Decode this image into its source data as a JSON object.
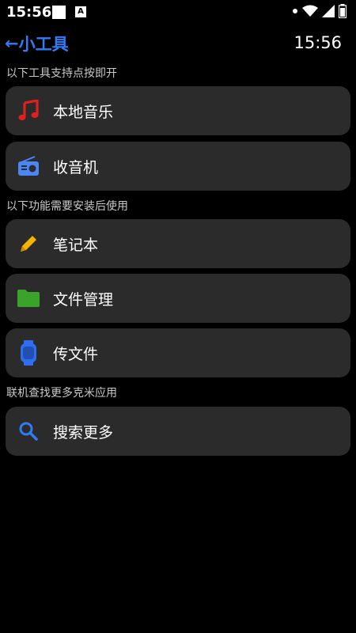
{
  "status_bar": {
    "time": "15:56",
    "notification_letter": "A"
  },
  "header": {
    "title": "小工具",
    "back_arrow": "←",
    "time": "15:56"
  },
  "sections": [
    {
      "label": "以下工具支持点按即开"
    },
    {
      "label": "以下功能需要安装后使用"
    },
    {
      "label": "联机查找更多克米应用"
    }
  ],
  "items": [
    {
      "label": "本地音乐",
      "icon": "music-note-icon",
      "color": "#e02020"
    },
    {
      "label": "收音机",
      "icon": "radio-icon",
      "color": "#4b86f5"
    },
    {
      "label": "笔记本",
      "icon": "pencil-icon",
      "color": "#f4b400"
    },
    {
      "label": "文件管理",
      "icon": "folder-icon",
      "color": "#3aa32a"
    },
    {
      "label": "传文件",
      "icon": "watch-icon",
      "color": "#2f6ef0"
    },
    {
      "label": "搜索更多",
      "icon": "search-icon",
      "color": "#2f7cf6"
    }
  ],
  "colors": {
    "accent": "#2f7cf6",
    "card_bg": "#2b2b2b",
    "background": "#000000"
  }
}
